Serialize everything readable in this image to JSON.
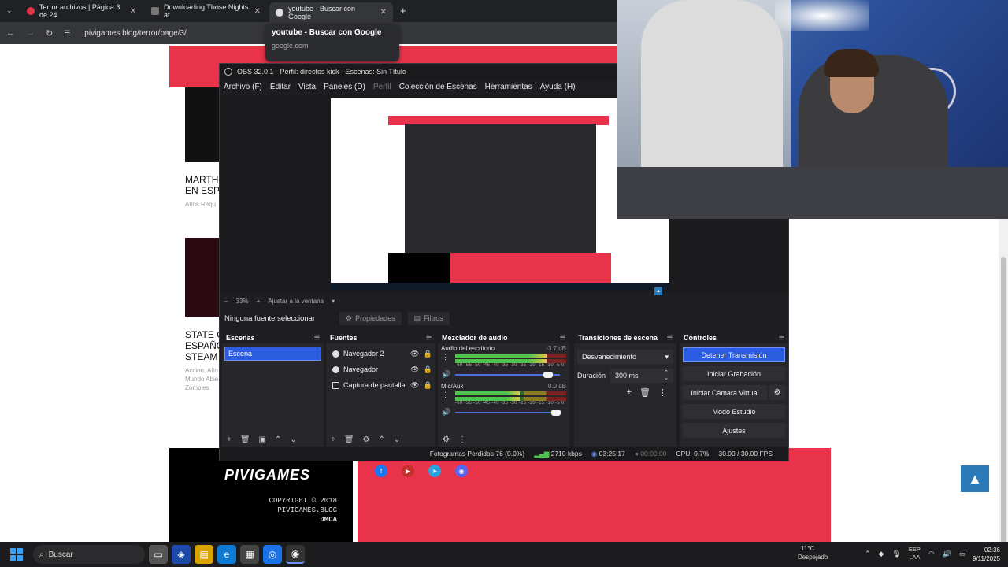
{
  "browser": {
    "tabs": [
      {
        "title": "Terror archivos | Página 3 de 24",
        "close": "✕"
      },
      {
        "title": "Downloading Those Nights at",
        "close": "✕"
      },
      {
        "title": "youtube - Buscar con Google",
        "close": "✕"
      }
    ],
    "new_tab": "+",
    "url": "pivigames.blog/terror/page/3/",
    "tooltip": {
      "title": "youtube - Buscar con Google",
      "domain": "google.com"
    }
  },
  "site": {
    "cards": [
      {
        "title1": "MARTH",
        "title2": "EN ESPA",
        "meta": "Altos Requ"
      },
      {
        "title1": "STATE O",
        "title2": "ESPAÑO",
        "title3": "STEAM",
        "meta1": "Accion, Alto",
        "meta2": "Mundo Abie",
        "meta3": "Zombies"
      }
    ],
    "footer": {
      "logo": "PIVIGAMES",
      "copyright": "COPYRIGHT © 2018 PIVIGAMES.BLOG",
      "dmca": "DMCA"
    },
    "scroll_top": "▲"
  },
  "obs": {
    "title": "OBS 32.0.1 - Perfil: directos kick - Escenas: Sin Título",
    "menu": [
      "Archivo (F)",
      "Editar",
      "Vista",
      "Paneles (D)",
      "Perfil",
      "Colección de Escenas",
      "Herramientas",
      "Ayuda (H)"
    ],
    "zoom": {
      "minus": "−",
      "percent": "33%",
      "plus": "+",
      "fit": "Ajustar a la ventana"
    },
    "source_bar": {
      "none_selected": "Ninguna fuente seleccionar",
      "properties": "Propiedades",
      "filters": "Filtros"
    },
    "scenes": {
      "title": "Escenas",
      "items": [
        "Escena"
      ]
    },
    "sources": {
      "title": "Fuentes",
      "items": [
        "Navegador 2",
        "Navegador",
        "Captura de pantalla"
      ]
    },
    "mixer": {
      "title": "Mezclador de audio",
      "scale": "-60 -55 -50 -45 -40 -35 -30 -25 -20 -15 -10 -5 0",
      "channels": [
        {
          "name": "Audio del escritorio",
          "db": "-3.7 dB",
          "level": 0.82,
          "volume": 0.92
        },
        {
          "name": "Mic/Aux",
          "db": "0.0 dB",
          "level": 0.58,
          "volume": 1.0
        }
      ]
    },
    "transitions": {
      "title": "Transiciones de escena",
      "selected": "Desvanecimiento",
      "duration_label": "Duración",
      "duration": "300 ms"
    },
    "controls": {
      "title": "Controles",
      "stop_stream": "Detener Transmisión",
      "start_recording": "Iniciar Grabación",
      "virtual_cam": "Iniciar Cámara Virtual",
      "studio_mode": "Modo Estudio",
      "settings": "Ajustes"
    },
    "status": {
      "dropped": "Fotogramas Perdidos 76 (0.0%)",
      "bitrate": "2710 kbps",
      "stream_time": "03:25:17",
      "rec_time": "00:00:00",
      "cpu": "CPU: 0.7%",
      "fps": "30.00 / 30.00 FPS"
    }
  },
  "taskbar": {
    "search": "Buscar",
    "weather_temp": "11°C",
    "weather_desc": "Despejado",
    "lang1": "ESP",
    "lang2": "LAA",
    "time": "02:36",
    "date": "9/11/2025"
  },
  "colors": {
    "accent": "#e8334a",
    "obs_primary": "#2c5ce0",
    "chrome_bg": "#202124"
  }
}
